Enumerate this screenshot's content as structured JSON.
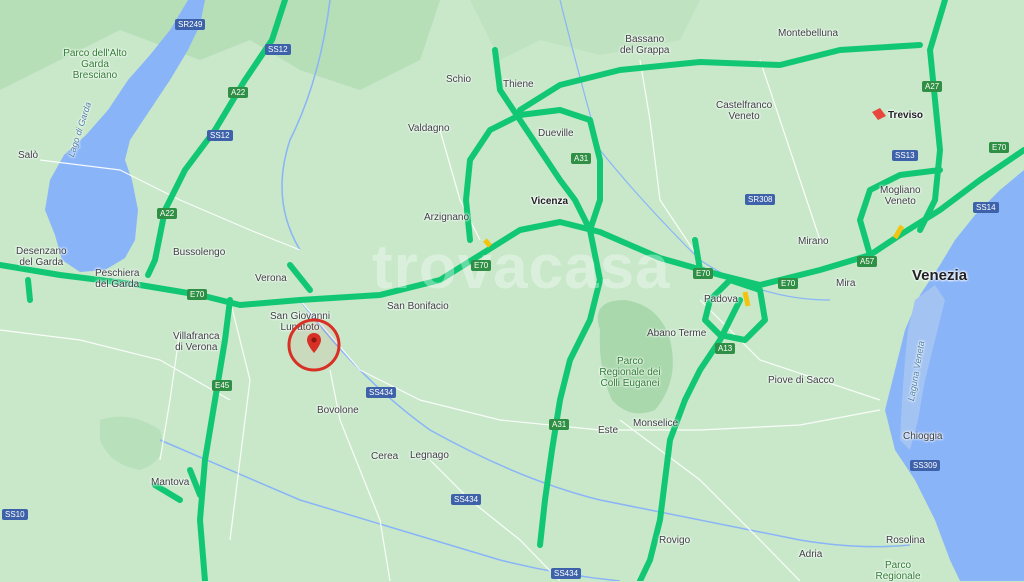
{
  "map": {
    "watermark": "trovacasa",
    "big_cities": [
      {
        "name": "Venezia"
      }
    ],
    "cities": [
      {
        "name": "Treviso"
      },
      {
        "name": "Vicenza"
      },
      {
        "name": "Verona"
      },
      {
        "name": "Padova"
      }
    ],
    "towns": [
      {
        "name": "Bassano\ndel Grappa"
      },
      {
        "name": "Montebelluna"
      },
      {
        "name": "Schio"
      },
      {
        "name": "Thiene"
      },
      {
        "name": "Valdagno"
      },
      {
        "name": "Castelfranco\nVeneto"
      },
      {
        "name": "Dueville"
      },
      {
        "name": "Salò"
      },
      {
        "name": "Arzignano"
      },
      {
        "name": "Mogliano\nVeneto"
      },
      {
        "name": "Desenzano\ndel Garda"
      },
      {
        "name": "Bussolengo"
      },
      {
        "name": "Peschiera\ndel Garda"
      },
      {
        "name": "Mirano"
      },
      {
        "name": "Mira"
      },
      {
        "name": "San Bonifacio"
      },
      {
        "name": "San Giovanni\nLupatoto"
      },
      {
        "name": "Villafranca\ndi Verona"
      },
      {
        "name": "Abano Terme"
      },
      {
        "name": "Piove di Sacco"
      },
      {
        "name": "Bovolone"
      },
      {
        "name": "Monselice"
      },
      {
        "name": "Este"
      },
      {
        "name": "Cerea"
      },
      {
        "name": "Legnago"
      },
      {
        "name": "Chioggia"
      },
      {
        "name": "Mantova"
      },
      {
        "name": "Rovigo"
      },
      {
        "name": "Adria"
      },
      {
        "name": "Rosolina"
      }
    ],
    "parks": [
      {
        "name": "Parco dell'Alto\nGarda\nBresciano"
      },
      {
        "name": "Parco\nRegionale dei\nColli Euganei"
      },
      {
        "name": "Parco\nRegionale"
      }
    ],
    "water_labels": [
      {
        "name": "Lago di Garda"
      },
      {
        "name": "Laguna Veneta"
      }
    ],
    "road_shields": [
      {
        "code": "SR249",
        "style": "blue"
      },
      {
        "code": "SS12",
        "style": "blue"
      },
      {
        "code": "A22",
        "style": "green"
      },
      {
        "code": "SS12",
        "style": "blue"
      },
      {
        "code": "A22",
        "style": "green"
      },
      {
        "code": "A27",
        "style": "green"
      },
      {
        "code": "A31",
        "style": "green"
      },
      {
        "code": "SS13",
        "style": "blue"
      },
      {
        "code": "E70",
        "style": "green"
      },
      {
        "code": "SR308",
        "style": "blue"
      },
      {
        "code": "SS14",
        "style": "blue"
      },
      {
        "code": "E70",
        "style": "green"
      },
      {
        "code": "E70",
        "style": "green"
      },
      {
        "code": "E70",
        "style": "green"
      },
      {
        "code": "E70",
        "style": "green"
      },
      {
        "code": "A57",
        "style": "green"
      },
      {
        "code": "A13",
        "style": "green"
      },
      {
        "code": "E45",
        "style": "green"
      },
      {
        "code": "SS434",
        "style": "blue"
      },
      {
        "code": "A31",
        "style": "green"
      },
      {
        "code": "SS434",
        "style": "blue"
      },
      {
        "code": "SS309",
        "style": "blue"
      },
      {
        "code": "SS10",
        "style": "blue"
      },
      {
        "code": "SS434",
        "style": "blue"
      }
    ],
    "marker": {
      "label": "property-location"
    },
    "colors": {
      "land": "#c8e8c9",
      "water": "#8ab4f8",
      "highway": "#12c773",
      "traffic_red": "#e8453c",
      "traffic_yellow": "#f2c40f"
    }
  }
}
